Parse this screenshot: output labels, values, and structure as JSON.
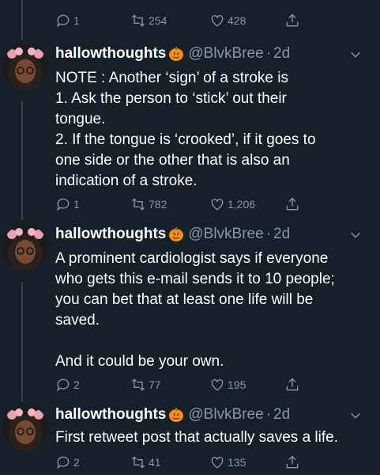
{
  "top_actions": {
    "reply": "1",
    "retweet": "254",
    "like": "428"
  },
  "tweets": [
    {
      "name": "hallowthoughts",
      "handle": "@BlvkBree",
      "dot": "·",
      "time": "2d",
      "lines": [
        "NOTE : Another ‘sign’ of a stroke is",
        "1. Ask the person to ‘stick’ out their",
        "tongue.",
        "2. If the tongue is ‘crooked’, if it goes to",
        "one side or the other that is also an",
        "indication of a stroke."
      ],
      "reply": "1",
      "retweet": "782",
      "like": "1,206"
    },
    {
      "name": "hallowthoughts",
      "handle": "@BlvkBree",
      "dot": "·",
      "time": "2d",
      "lines": [
        "A prominent cardiologist says if everyone",
        "who gets this e-mail sends it to 10 people;",
        "you can bet that at least one life will be",
        "saved.",
        "",
        "And it could be your own."
      ],
      "reply": "2",
      "retweet": "77",
      "like": "195"
    },
    {
      "name": "hallowthoughts",
      "handle": "@BlvkBree",
      "dot": "·",
      "time": "2d",
      "lines": [
        "First retweet post that actually saves a life."
      ],
      "reply": "2",
      "retweet": "41",
      "like": "135"
    }
  ],
  "colors": {
    "background": "#15202b",
    "muted": "#8899a6",
    "pumpkin": "#f4900c"
  }
}
